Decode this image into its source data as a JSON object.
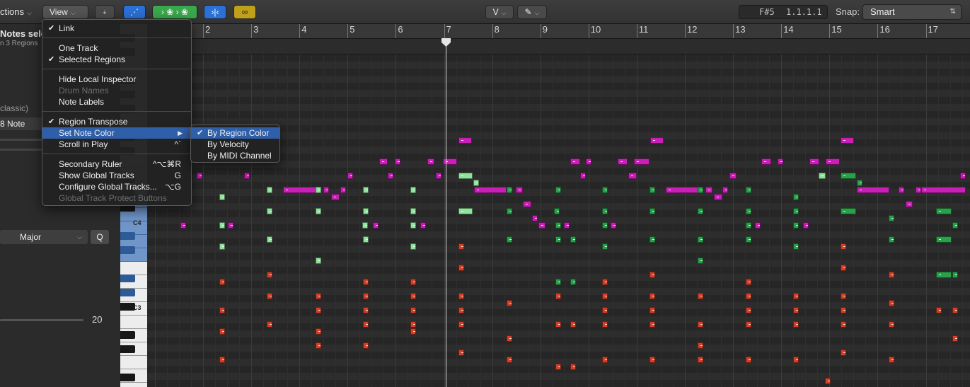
{
  "toolbar": {
    "functions_label": "ctions",
    "view_label": "View",
    "lcd_pitch": "F#5",
    "lcd_position": "1.1.1.1",
    "snap_label": "Snap:",
    "snap_value": "Smart",
    "tool_left": "V",
    "colors": {
      "blue_button": "#2b70d6",
      "green_button": "#3aa84c",
      "yellow_button": "#bfa01a"
    }
  },
  "inspector": {
    "selection_title": "Notes sele",
    "selection_sub": "n 3 Regions",
    "instrument": "classic)",
    "quantize_value": "8 Note",
    "scale_value": "Major",
    "q_button": "Q",
    "strength_value": "20"
  },
  "keyboard": {
    "label_c4": "C4",
    "label_c3": "C3"
  },
  "ruler": {
    "bars": [
      "2",
      "3",
      "4",
      "5",
      "6",
      "7",
      "8",
      "9",
      "10",
      "11",
      "12",
      "13",
      "14",
      "15",
      "16",
      "17"
    ]
  },
  "view_menu": {
    "items": [
      {
        "label": "Link",
        "checked": true
      },
      {
        "label": "One Track",
        "checked": false
      },
      {
        "label": "Selected Regions",
        "checked": true
      },
      {
        "label": "Hide Local Inspector",
        "checked": false
      },
      {
        "label": "Drum Names",
        "disabled": true
      },
      {
        "label": "Note Labels",
        "checked": false
      },
      {
        "label": "Region Transpose",
        "checked": true
      },
      {
        "label": "Set Note Color",
        "submenu": true
      },
      {
        "label": "Scroll in Play",
        "shortcut": "^`"
      },
      {
        "label": "Secondary Ruler",
        "shortcut": "^⌥⌘R"
      },
      {
        "label": "Show Global Tracks",
        "shortcut": "G"
      },
      {
        "label": "Configure Global Tracks...",
        "shortcut": "⌥G"
      },
      {
        "label": "Global Track Protect Buttons",
        "disabled": true
      }
    ]
  },
  "color_submenu": {
    "items": [
      {
        "label": "By Region Color",
        "checked": true
      },
      {
        "label": "By Velocity",
        "checked": false
      },
      {
        "label": "By MIDI Channel",
        "checked": false
      }
    ]
  },
  "note_colors": {
    "magenta": "#c81fb6",
    "green": "#29a04a",
    "light_green": "#8fe39d",
    "red": "#d44028"
  }
}
